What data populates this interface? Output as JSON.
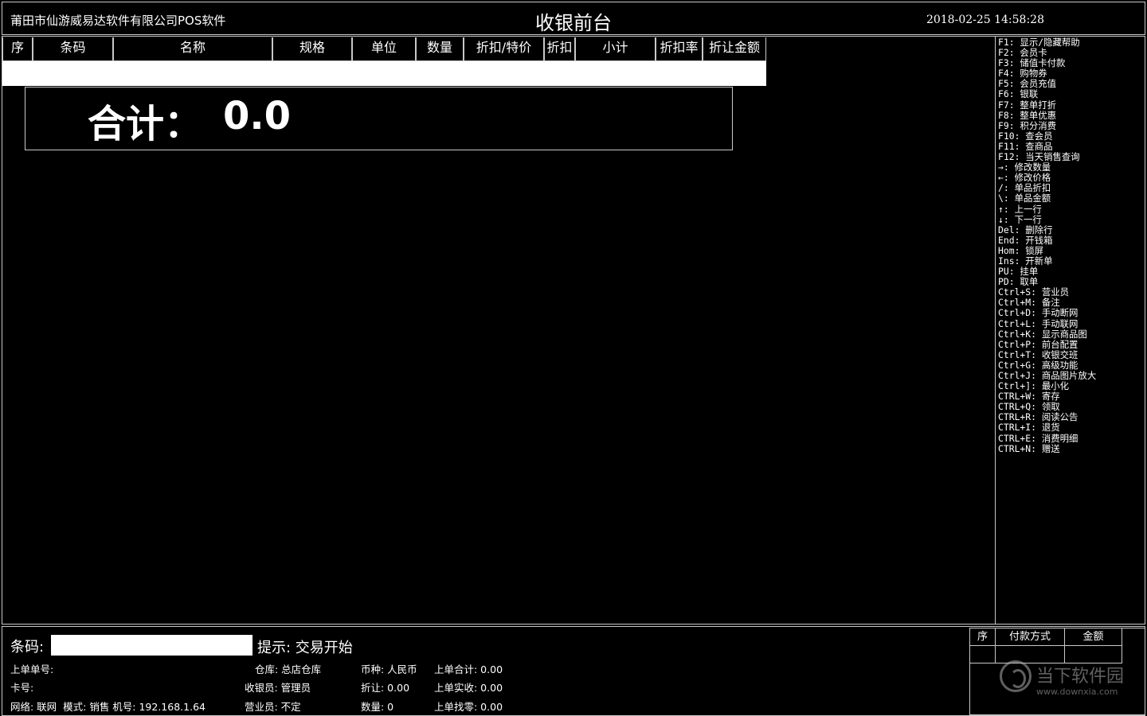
{
  "header": {
    "company": "莆田市仙游威易达软件有限公司POS软件",
    "title": "收银前台",
    "datetime": "2018-02-25 14:58:28"
  },
  "grid": {
    "columns": [
      "序",
      "条码",
      "名称",
      "规格",
      "单位",
      "数量",
      "折扣/特价",
      "折扣",
      "小计",
      "折扣率",
      "折让金额"
    ]
  },
  "total": {
    "label": "合计：",
    "value": "0.0"
  },
  "help": [
    "F1: 显示/隐藏帮助",
    "F2: 会员卡",
    "F3: 储值卡付款",
    "F4: 购物券",
    "F5: 会员充值",
    "F6: 银联",
    "F7: 整单打折",
    "F8: 整单优惠",
    "F9: 积分消费",
    "F10: 查会员",
    "F11: 查商品",
    "F12: 当天销售查询",
    "→: 修改数量",
    "←: 修改价格",
    "/: 单品折扣",
    "\\: 单品金额",
    "↑: 上一行",
    "↓: 下一行",
    "Del: 删除行",
    "End: 开钱箱",
    "Hom: 锁屏",
    "Ins: 开新单",
    "PU: 挂单",
    "PD: 取单",
    "Ctrl+S: 营业员",
    "Ctrl+M: 备注",
    "Ctrl+D: 手动断网",
    "Ctrl+L: 手动联网",
    "Ctrl+K: 显示商品图",
    "Ctrl+P: 前台配置",
    "Ctrl+T: 收银交班",
    "Ctrl+G: 高级功能",
    "Ctrl+J: 商品图片放大",
    "Ctrl+]: 最小化",
    "CTRL+W: 寄存",
    "CTRL+Q: 领取",
    "CTRL+R: 阅读公告",
    "CTRL+I: 退货",
    "CTRL+E: 消费明细",
    "CTRL+N: 赠送"
  ],
  "bottom": {
    "barcode_label": "条码:",
    "barcode_value": "",
    "hint": "提示: 交易开始",
    "last_order": "上单单号:",
    "card": "卡号:",
    "network": "网络: 联网  模式: 销售 机号: 192.168.1.64",
    "warehouse": "仓库: 总店仓库",
    "cashier": "收银员: 管理员",
    "salesperson": "营业员: 不定",
    "currency": "币种: 人民币",
    "discount": "折让: 0.00",
    "quantity": "数量: 0",
    "last_total": "上单合计: 0.00",
    "last_paid": "上单实收: 0.00",
    "last_change": "上单找零: 0.00"
  },
  "payment": {
    "columns": [
      "序",
      "付款方式",
      "金额"
    ]
  },
  "watermark": {
    "text": "当下软件园",
    "url": "www.downxia.com"
  }
}
